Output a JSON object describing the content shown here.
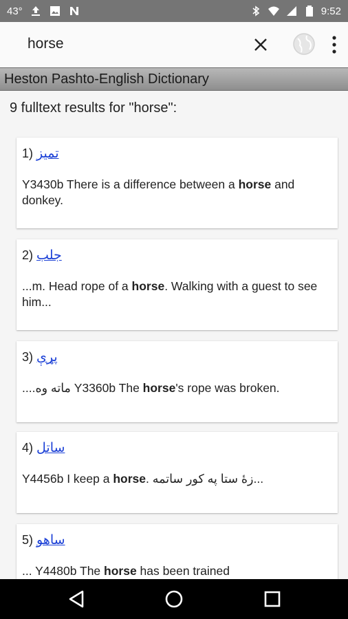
{
  "status": {
    "temp": "43°",
    "time": "9:52",
    "icons_left": [
      "upload-icon",
      "image-icon",
      "n-logo-icon"
    ],
    "icons_right": [
      "bluetooth-icon",
      "wifi-icon",
      "signal-icon",
      "battery-icon"
    ]
  },
  "search": {
    "query": "horse",
    "clear_icon": "close-icon",
    "globe_icon": "globe-icon",
    "more_icon": "more-vert-icon"
  },
  "dictionary": {
    "title": "Heston Pashto-English Dictionary"
  },
  "results_count": "9 fulltext results for \"horse\":",
  "results": [
    {
      "num": "1)",
      "word": "تمیز",
      "parts": [
        {
          "t": "Y3430b There is a difference between a ",
          "b": false
        },
        {
          "t": "horse",
          "b": true
        },
        {
          "t": " and donkey.",
          "b": false
        }
      ]
    },
    {
      "num": "2)",
      "word": "جلب",
      "parts": [
        {
          "t": "...m. Head rope of a ",
          "b": false
        },
        {
          "t": "horse",
          "b": true
        },
        {
          "t": ". Walking with a guest to see him...",
          "b": false
        }
      ]
    },
    {
      "num": "3)",
      "word": "پړې",
      "parts": [
        {
          "t": "....ماته وه Y3360b The ",
          "b": false
        },
        {
          "t": "horse",
          "b": true
        },
        {
          "t": "'s rope was broken.",
          "b": false
        }
      ]
    },
    {
      "num": "4)",
      "word": "ساتل",
      "parts": [
        {
          "t": "Y4456b I keep a ",
          "b": false
        },
        {
          "t": "horse",
          "b": true
        },
        {
          "t": ". زهٔ ستا په کور ساتمه...",
          "b": false
        }
      ]
    },
    {
      "num": "5)",
      "word": "ساهو",
      "parts": [
        {
          "t": "... Y4480b The ",
          "b": false
        },
        {
          "t": "horse",
          "b": true
        },
        {
          "t": " has been trained",
          "b": false
        }
      ]
    }
  ],
  "nav": {
    "back_icon": "back-icon",
    "home_icon": "home-icon",
    "recents_icon": "recents-icon"
  },
  "colors": {
    "link": "#1a3fd6",
    "status_bar": "#757575",
    "header": "#9e9e9e"
  }
}
